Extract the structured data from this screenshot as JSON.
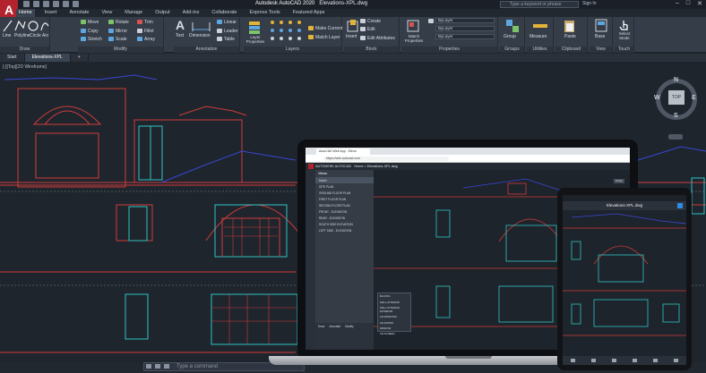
{
  "app": {
    "logo_letter": "A",
    "title": "Autodesk AutoCAD 2020",
    "file": "Elevations-XPL.dwg",
    "search_placeholder": "Type a keyword or phrase",
    "signin": "Sign In",
    "window_controls": [
      "–",
      "□",
      "✕"
    ]
  },
  "menu_tabs": [
    "Home",
    "Insert",
    "Annotate",
    "View",
    "Manage",
    "Output",
    "Add-ins",
    "Collaborate",
    "Express Tools",
    "Featured Apps"
  ],
  "ribbon": {
    "draw": {
      "title": "Draw",
      "line": "Line",
      "polyline": "Polyline",
      "circle": "Circle",
      "arc": "Arc"
    },
    "modify": {
      "title": "Modify",
      "tools": [
        "Move",
        "Rotate",
        "Trim",
        "Copy",
        "Mirror",
        "Fillet",
        "Stretch",
        "Scale",
        "Array"
      ]
    },
    "annotation": {
      "title": "Annotation",
      "text": "Text",
      "dimension": "Dimension",
      "tools": [
        "Linear",
        "Leader",
        "Table"
      ]
    },
    "layers": {
      "title": "Layers",
      "layer_properties": "Layer Properties",
      "tools": [
        "Make Current",
        "Match Layer"
      ]
    },
    "block": {
      "title": "Block",
      "insert": "Insert",
      "tools": [
        "Create",
        "Edit",
        "Edit Attributes"
      ]
    },
    "properties": {
      "title": "Properties",
      "match": "Match Properties",
      "values": [
        "ByLayer",
        "ByLayer",
        "ByLayer"
      ]
    },
    "groups": {
      "title": "Groups",
      "group": "Group"
    },
    "utilities": {
      "title": "Utilities",
      "measure": "Measure"
    },
    "clipboard": {
      "title": "Clipboard",
      "paste": "Paste"
    },
    "view": {
      "title": "View",
      "base": "Base"
    },
    "touch": {
      "title": "Touch",
      "select_mode": "Select Mode"
    }
  },
  "doc_tabs": [
    "Start",
    "Elevations-XPL"
  ],
  "viewport_label": "[-][Top][2D Wireframe]",
  "viewcube": {
    "face": "TOP",
    "n": "N",
    "s": "S",
    "e": "E",
    "w": "W"
  },
  "command_placeholder": "Type a command",
  "laptop": {
    "tab_title": "AutoCAD Web App - Eleva",
    "url": "https://web.autocad.com",
    "header": "AUTODESK AUTOCAD",
    "crumb": "Home > Elevations-XPL.dwg",
    "nav_header": "Views",
    "nav_items": [
      "Model",
      "SITE PLAN",
      "GROUND FLOOR PLAN",
      "FIRST FLOOR PLAN",
      "SECOND FLOOR PLAN",
      "FRONT - ELEVATION",
      "REAR - ELEVATION",
      "SOUTH SIDE ELEVATION",
      "LEFT SIDE - ELEVATION"
    ],
    "tool_tabs": [
      "Draw",
      "Annotate",
      "Modify"
    ],
    "close": "Close",
    "popup": [
      "BLOCKS",
      "WALL-INTERIOR",
      "WALL-INTERIOR-EXTERIOR",
      "AR-WINDOWS",
      "AR-DOORS",
      "WINDOW",
      "AR-SCREEN"
    ]
  },
  "tablet": {
    "title": "Elevations-XPL.dwg"
  }
}
